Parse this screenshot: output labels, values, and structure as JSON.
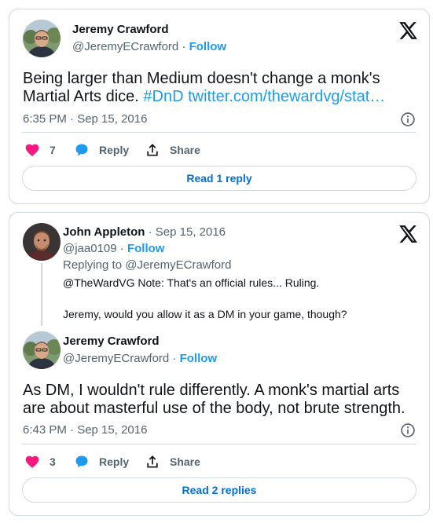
{
  "tweet1": {
    "author_name": "Jeremy Crawford",
    "author_handle": "@JeremyECrawford",
    "separator": "·",
    "follow_label": "Follow",
    "text_line1": "Being larger than Medium doesn't change a monk's",
    "text_line2_plain": "Martial Arts dice. ",
    "hashtag": "#DnD",
    "link": "twitter.com/thewardvg/stat…",
    "timestamp": "6:35 PM · Sep 15, 2016",
    "like_count": "7",
    "reply_label": "Reply",
    "share_label": "Share",
    "read_replies_label": "Read 1 reply"
  },
  "tweet2": {
    "quoted": {
      "author_name": "John Appleton",
      "separator": "·",
      "date": "Sep 15, 2016",
      "author_handle": "@jaa0109",
      "follow_label": "Follow",
      "replying_to": "Replying to @JeremyECrawford",
      "text_line1": "@TheWardVG Note: That's an official rules... Ruling.",
      "text_line2": "Jeremy, would you allow it as a DM in your game, though?"
    },
    "main": {
      "author_name": "Jeremy Crawford",
      "author_handle": "@JeremyECrawford",
      "separator": "·",
      "follow_label": "Follow",
      "text_line1": "As DM, I wouldn't rule differently. A monk's martial arts",
      "text_line2": "are about masterful use of the body, not brute strength.",
      "timestamp": "6:43 PM · Sep 15, 2016",
      "like_count": "3",
      "reply_label": "Reply",
      "share_label": "Share",
      "read_replies_label": "Read 2 replies"
    }
  },
  "colors": {
    "accent": "#1d9bf0",
    "like": "#f91880",
    "muted": "#536471",
    "border": "#cfd9de"
  },
  "icons": [
    "avatar-jeremy",
    "avatar-john",
    "x-logo-icon",
    "info-icon",
    "heart-icon",
    "speech-bubble-icon",
    "share-icon"
  ]
}
